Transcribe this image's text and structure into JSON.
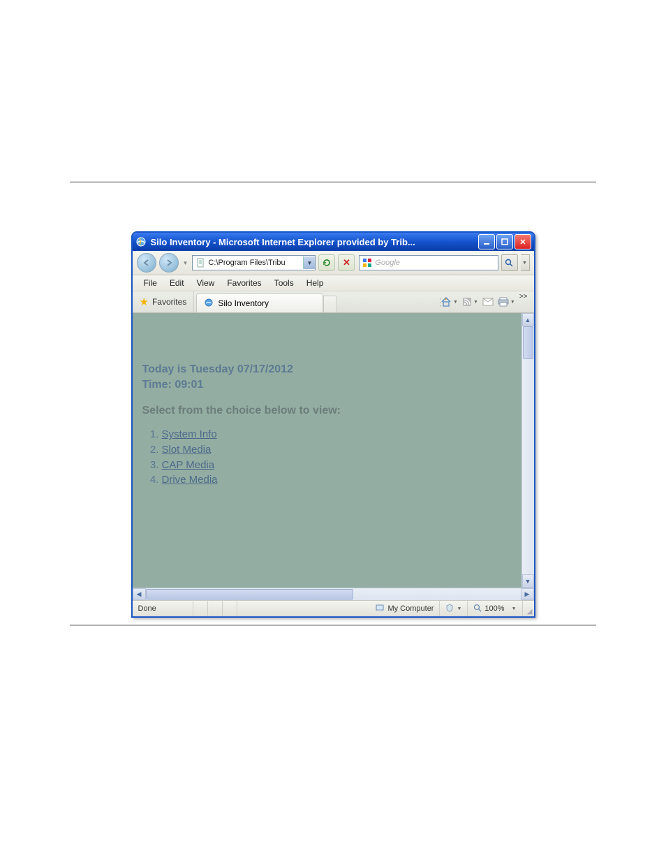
{
  "window": {
    "title": "Silo Inventory - Microsoft Internet Explorer provided by Trib..."
  },
  "nav": {
    "address": "C:\\Program Files\\Tribu",
    "search_placeholder": "Google"
  },
  "menu": {
    "file": "File",
    "edit": "Edit",
    "view": "View",
    "favorites": "Favorites",
    "tools": "Tools",
    "help": "Help"
  },
  "tabs": {
    "favorites_label": "Favorites",
    "active_tab": "Silo Inventory",
    "overflow": ">>"
  },
  "content": {
    "date_line": "Today is Tuesday 07/17/2012",
    "time_line": "Time: 09:01",
    "prompt": "Select from the choice below to view:",
    "links": {
      "l1": "System Info",
      "l2": "Slot Media",
      "l3": "CAP Media",
      "l4": "Drive Media"
    }
  },
  "status": {
    "left": "Done",
    "zone": "My Computer",
    "zoom": "100%"
  }
}
